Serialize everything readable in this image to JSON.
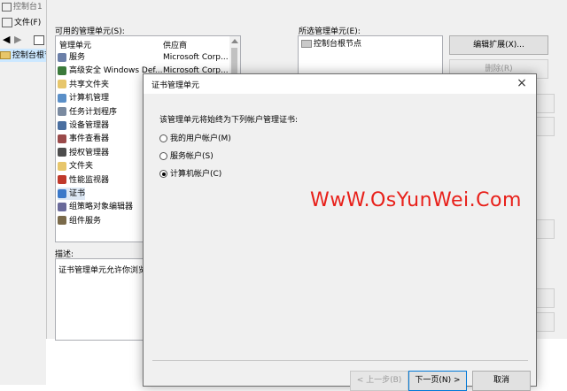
{
  "mmc": {
    "title": "控制台1",
    "menu_file": "文件(F)",
    "tree_root": "控制台根节"
  },
  "snapin_dialog": {
    "available_label": "可用的管理单元(S):",
    "selected_label": "所选管理单元(E):",
    "columns": {
      "name": "管理单元",
      "vendor": "供应商"
    },
    "items": [
      {
        "label": "服务",
        "vendor": "Microsoft Corp...",
        "icon": "services-icon",
        "color": "#6b7fa8"
      },
      {
        "label": "高级安全 Windows Def...",
        "vendor": "Microsoft Corp...",
        "icon": "firewall-icon",
        "color": "#3b7a3b"
      },
      {
        "label": "共享文件夹",
        "icon": "shared-folder-icon",
        "color": "#e7c66b"
      },
      {
        "label": "计算机管理",
        "icon": "computer-management-icon",
        "color": "#5a8fc8"
      },
      {
        "label": "任务计划程序",
        "icon": "task-scheduler-icon",
        "color": "#7a8aa0"
      },
      {
        "label": "设备管理器",
        "icon": "device-manager-icon",
        "color": "#4a6fa0"
      },
      {
        "label": "事件查看器",
        "icon": "event-viewer-icon",
        "color": "#9a4a4a"
      },
      {
        "label": "授权管理器",
        "icon": "authorization-icon",
        "color": "#4d4d4d"
      },
      {
        "label": "文件夹",
        "icon": "folder-icon",
        "color": "#e7c66b"
      },
      {
        "label": "性能监视器",
        "icon": "performance-icon",
        "color": "#c0392b"
      },
      {
        "label": "证书",
        "icon": "certificate-icon",
        "color": "#3a78c9"
      },
      {
        "label": "组策略对象编辑器",
        "icon": "group-policy-icon",
        "color": "#6a6a9a"
      },
      {
        "label": "组件服务",
        "icon": "component-services-icon",
        "color": "#7a6a4a"
      }
    ],
    "selected_root": "控制台根节点",
    "description_label": "描述:",
    "description_text": "证书管理单元允许你浏览",
    "btn_edit_ext": "编辑扩展(X)...",
    "btn_remove": "删除(R)"
  },
  "cert_dialog": {
    "title": "证书管理单元",
    "close_glyph": "×",
    "prompt": "该管理单元将始终为下列帐户管理证书:",
    "options": [
      {
        "label": "我的用户帐户(M)",
        "checked": false
      },
      {
        "label": "服务帐户(S)",
        "checked": false
      },
      {
        "label": "计算机帐户(C)",
        "checked": true
      }
    ],
    "btn_back": "< 上一步(B)",
    "btn_next": "下一页(N) >",
    "btn_cancel": "取消"
  },
  "watermark": "WwW.OsYunWei.Com"
}
